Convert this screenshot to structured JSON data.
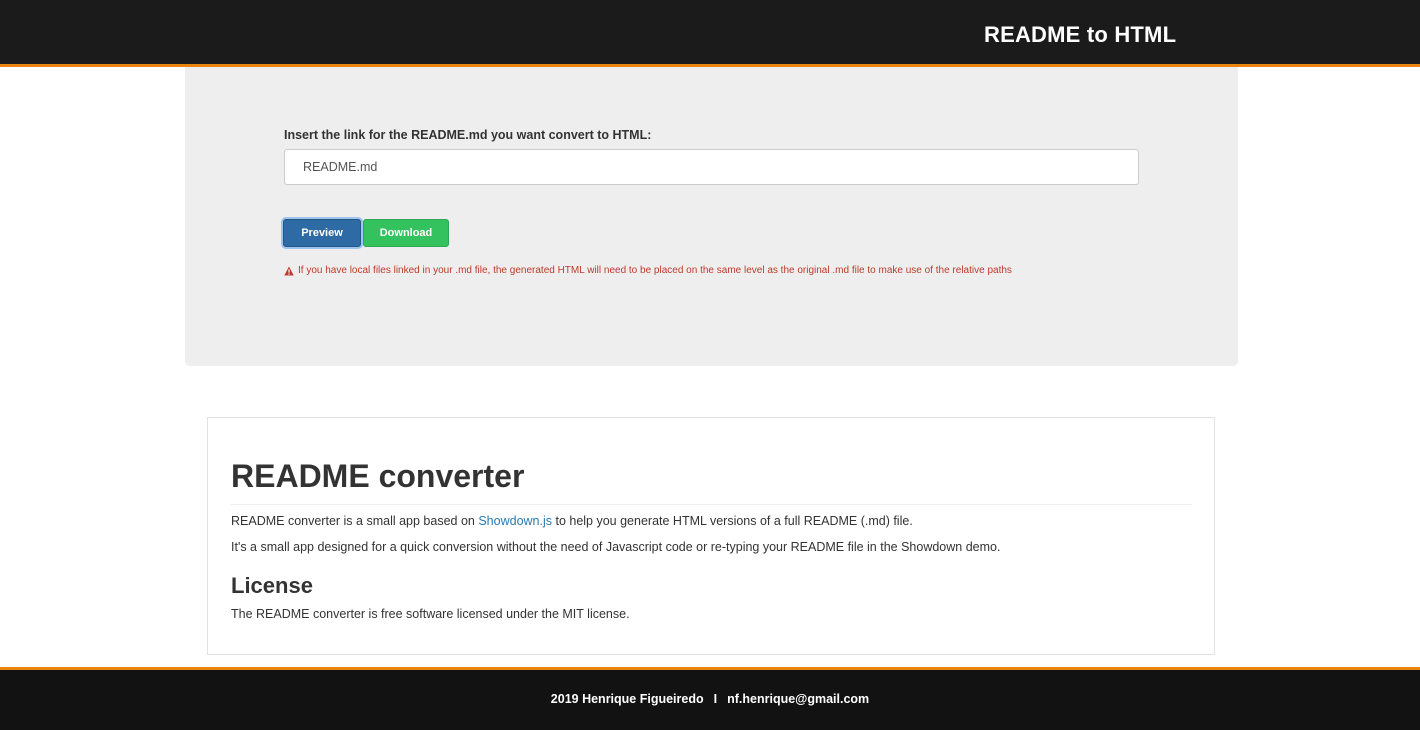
{
  "header": {
    "title": "README to HTML"
  },
  "form": {
    "label": "Insert the link for the README.md you want convert to HTML:",
    "input_value": "README.md",
    "preview_label": "Preview",
    "download_label": "Download",
    "warning_icon": "warning-triangle-icon",
    "warning_text": "If you have local files linked in your .md file, the generated HTML will need to be placed on the same level as the original .md file to make use of the relative paths"
  },
  "readme": {
    "title": "README converter",
    "p1_before": "README converter is a small app based on ",
    "p1_link": "Showdown.js",
    "p1_after": " to help you generate HTML versions of a full README (.md) file.",
    "p2": "It's a small app designed for a quick conversion without the need of Javascript code or re-typing your README file in the Showdown demo.",
    "license_heading": "License",
    "p3": "The README converter is free software licensed under the MIT license."
  },
  "footer": {
    "copyright": "2019 Henrique Figueiredo",
    "separator": "I",
    "email": "nf.henrique@gmail.com"
  },
  "colors": {
    "header_bg": "#1b1b1b",
    "accent": "#e8850f",
    "preview_button": "#2e6aa3",
    "download_button": "#34c25f",
    "warning": "#c0392b",
    "link": "#2a7ab0"
  }
}
